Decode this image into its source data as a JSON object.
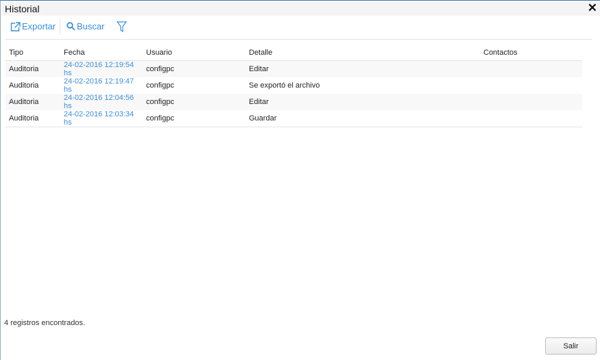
{
  "window": {
    "title": "Historial",
    "close_icon": "close-icon"
  },
  "toolbar": {
    "export_label": "Exportar",
    "search_label": "Buscar",
    "filter_icon": "filter-icon"
  },
  "table": {
    "columns": [
      "Tipo",
      "Fecha",
      "Usuario",
      "Detalle",
      "Contactos"
    ],
    "rows": [
      [
        "Auditoria",
        "24-02-2016 12:19:54 hs",
        "configpc",
        "Editar",
        ""
      ],
      [
        "Auditoria",
        "24-02-2016 12:19:47 hs",
        "configpc",
        "Se exportó el archivo",
        ""
      ],
      [
        "Auditoria",
        "24-02-2016 12:04:56 hs",
        "configpc",
        "Editar",
        ""
      ],
      [
        "Auditoria",
        "24-02-2016 12:03:34 hs",
        "configpc",
        "Guardar",
        ""
      ]
    ]
  },
  "status": "4 registros encontrados.",
  "footer": {
    "exit_label": "Salir"
  },
  "colors": {
    "accent": "#3a8fd8"
  }
}
